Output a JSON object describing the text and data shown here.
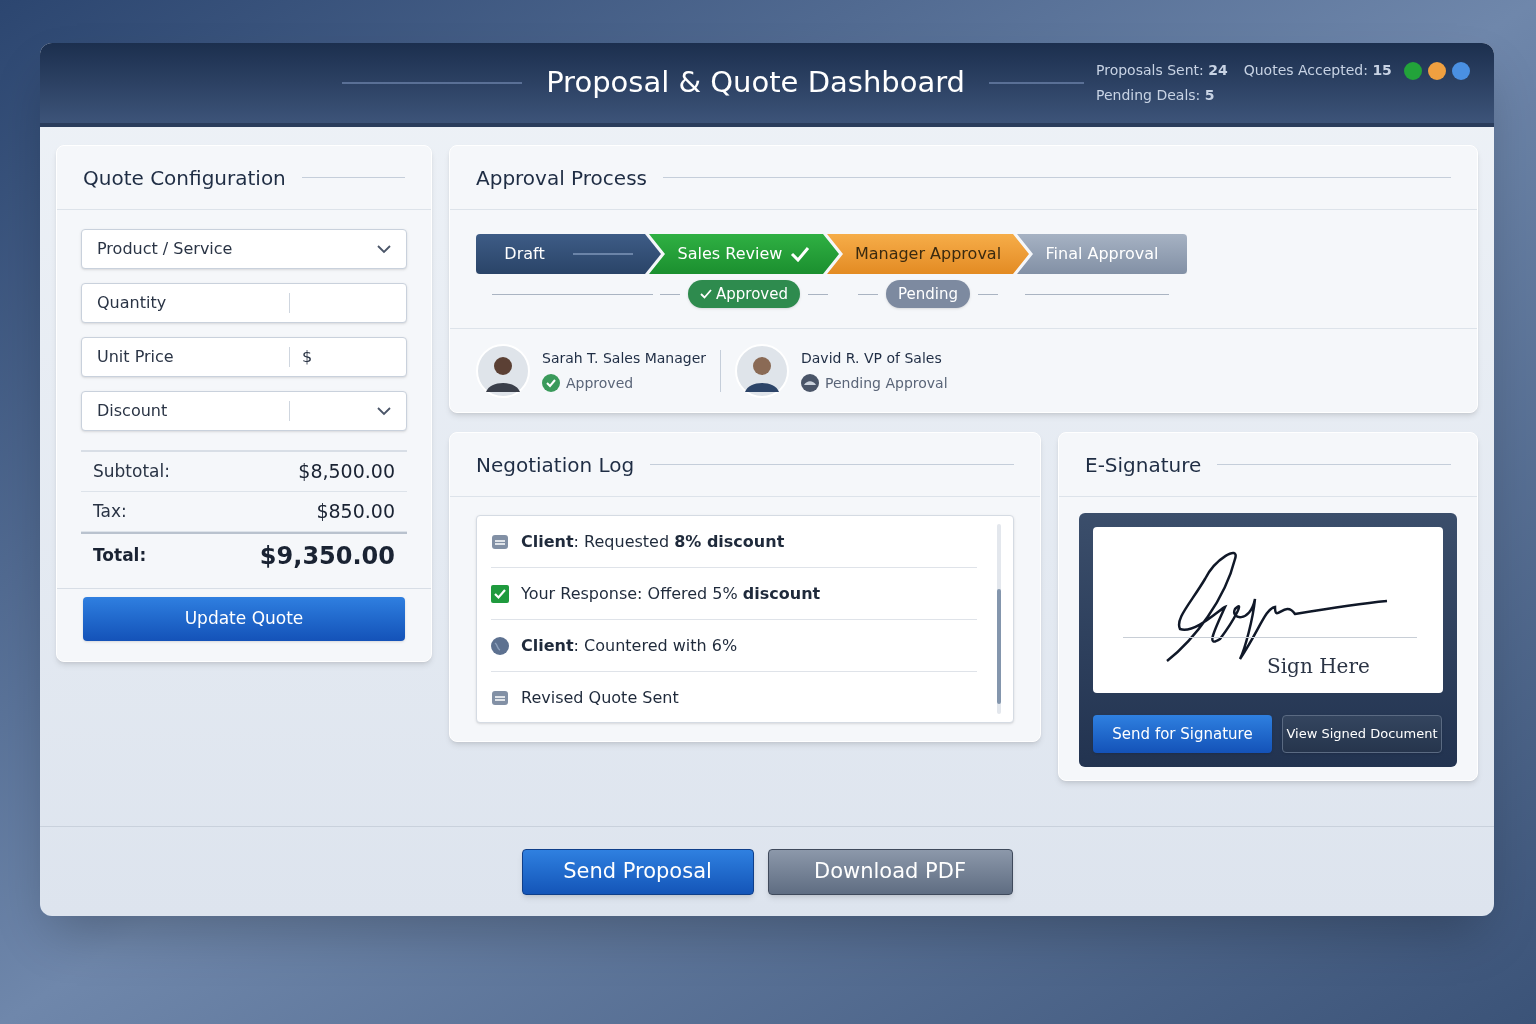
{
  "header": {
    "title": "Proposal & Quote Dashboard",
    "stat_rows": [
      [
        {
          "text": "Proposals Sent: **24**"
        },
        {
          "text": "Quotes Accepted: **15**"
        }
      ],
      [
        {
          "text": "Pending Deals: **5**"
        }
      ]
    ],
    "status_dots": [
      {
        "color": "#22a33a"
      },
      {
        "color": "#f0a040"
      },
      {
        "color": "#4a90e2"
      }
    ]
  },
  "quote_config": {
    "title": "Quote Configuration",
    "fields": [
      {
        "kind": "select",
        "label": "Product / Service"
      },
      {
        "kind": "number",
        "label": "Quantity"
      },
      {
        "kind": "price",
        "label": "Unit Price",
        "prefix": "$"
      },
      {
        "kind": "dropdown",
        "label": "Discount"
      }
    ],
    "summary": [
      {
        "kind": "line",
        "label": "Subtotal:",
        "value": "$8,500.00"
      },
      {
        "kind": "line",
        "label": "Tax:",
        "value": "$850.00"
      },
      {
        "kind": "total",
        "label": "Total:",
        "value": "$9,350.00"
      }
    ],
    "button": "Update Quote"
  },
  "approval": {
    "title": "Approval Process",
    "steps": [
      {
        "label": "Draft",
        "kind": "draft"
      },
      {
        "label": "Sales Review",
        "kind": "approved",
        "badge": "Approved"
      },
      {
        "label": "Manager Approval",
        "kind": "current",
        "badge": "Pending"
      },
      {
        "label": "Final Approval",
        "kind": "upcoming"
      }
    ],
    "approvers": [
      {
        "name": "Sarah T. Sales Manager",
        "status": "Approved",
        "kind": "approved"
      },
      {
        "name": "David R. VP of Sales",
        "status": "Pending Approval",
        "kind": "pending"
      }
    ]
  },
  "negotiation": {
    "title": "Negotiation Log",
    "entries": [
      {
        "kind": "note",
        "text": "**Client**: Requested **8% discount**"
      },
      {
        "kind": "response",
        "text": "Your Response: Offered 5% **discount**"
      },
      {
        "kind": "counter",
        "text": "**Client**: Countered with 6%"
      },
      {
        "kind": "note",
        "text": "Revised Quote Sent"
      }
    ]
  },
  "signature": {
    "title": "E-Signature",
    "hint": "Sign Here",
    "buttons": [
      {
        "kind": "primary",
        "label": "Send for Signature"
      },
      {
        "kind": "secondary",
        "label": "View Signed Document"
      }
    ]
  },
  "actions": [
    {
      "kind": "primary",
      "label": "Send Proposal"
    },
    {
      "kind": "secondary",
      "label": "Download PDF"
    }
  ]
}
